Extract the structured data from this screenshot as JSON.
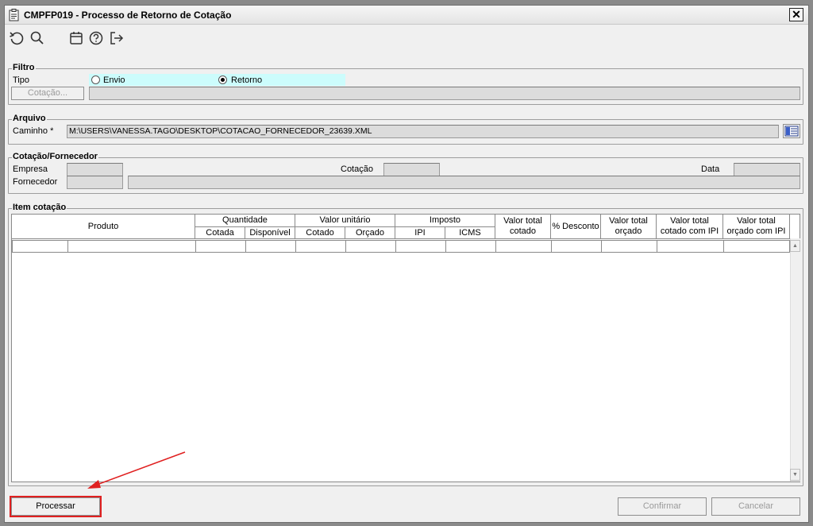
{
  "window": {
    "title": "CMPFP019 - Processo de Retorno de Cotação",
    "close_label": "✕"
  },
  "toolbar": {
    "icons": [
      "undo-icon",
      "search-icon",
      "calendar-icon",
      "help-icon",
      "exit-icon"
    ]
  },
  "filtro": {
    "title": "Filtro",
    "tipo_label": "Tipo",
    "options": [
      "Envio",
      "Retorno"
    ],
    "selected": "Retorno",
    "cotacao_button": "Cotação...",
    "cotacao_value": ""
  },
  "arquivo": {
    "title": "Arquivo",
    "caminho_label": "Caminho *",
    "caminho_value": "M:\\USERS\\VANESSA.TAGO\\DESKTOP\\COTACAO_FORNECEDOR_23639.XML"
  },
  "cotacao_fornecedor": {
    "title": "Cotação/Fornecedor",
    "empresa_label": "Empresa",
    "cotacao_label": "Cotação",
    "data_label": "Data",
    "fornecedor_label": "Fornecedor"
  },
  "item_cotacao": {
    "title": "Item cotação",
    "header_groups": {
      "produto": "Produto",
      "quantidade": "Quantidade",
      "valor_unitario": "Valor unitário",
      "imposto": "Imposto"
    },
    "sub_headers": {
      "cotada": "Cotada",
      "disponivel": "Disponível",
      "cotado": "Cotado",
      "orcado": "Orçado",
      "ipi": "IPI",
      "icms": "ICMS"
    },
    "single_headers": {
      "valor_total_cotado": "Valor total cotado",
      "desconto": "% Desconto",
      "valor_total_orcado": "Valor total orçado",
      "valor_total_cotado_ipi": "Valor total cotado com IPI",
      "valor_total_orcado_ipi": "Valor total orçado com IPI"
    }
  },
  "footer": {
    "processar": "Processar",
    "confirmar": "Confirmar",
    "cancelar": "Cancelar"
  },
  "colors": {
    "highlight_radio_bg": "#ccfcfc",
    "annotation_red": "#e02020"
  }
}
